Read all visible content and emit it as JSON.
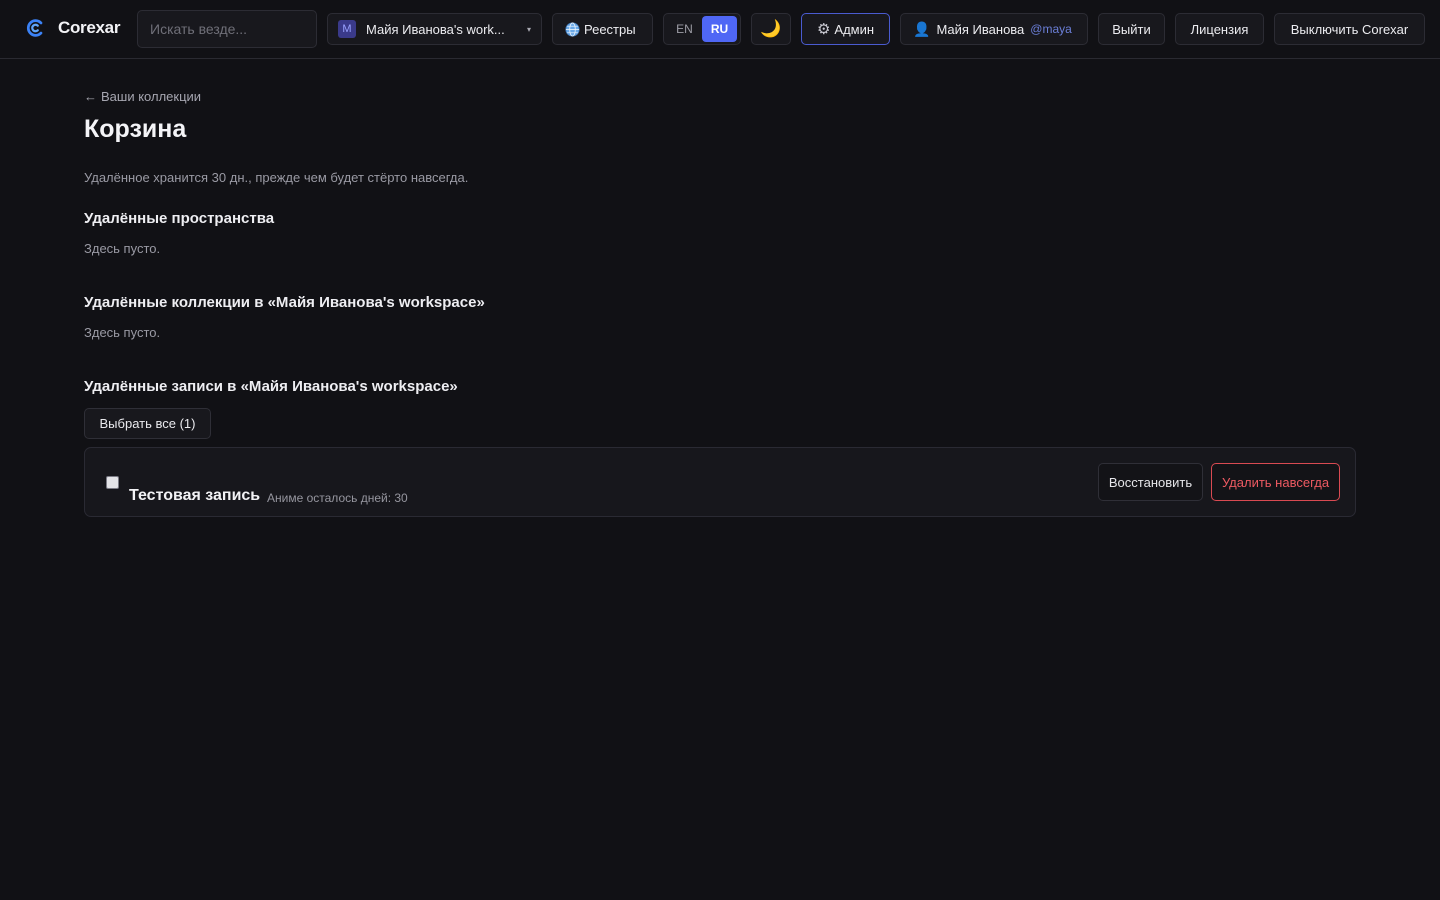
{
  "app": {
    "name": "Corexar"
  },
  "header": {
    "search_placeholder": "Искать везде...",
    "workspace": {
      "badge": "M",
      "name": "Майя Иванова's work..."
    },
    "registries_label": "Реестры",
    "languages": [
      {
        "code": "EN",
        "active": false
      },
      {
        "code": "RU",
        "active": true
      }
    ],
    "theme_icon": "🌙",
    "admin_label": "Админ",
    "user": {
      "name": "Майя Иванова",
      "handle": "@maya"
    },
    "logout_label": "Выйти",
    "license_label": "Лицензия",
    "shutdown_label": "Выключить Corexar"
  },
  "page": {
    "back_label": "Ваши коллекции",
    "title": "Корзина",
    "retention_note": "Удалённое хранится 30 дн., прежде чем будет стёрто навсегда.",
    "sections": {
      "spaces": {
        "heading": "Удалённые пространства",
        "empty_text": "Здесь пусто."
      },
      "collections": {
        "heading": "Удалённые коллекции в «Майя Иванова's workspace»",
        "empty_text": "Здесь пусто."
      },
      "records": {
        "heading": "Удалённые записи в «Майя Иванова's workspace»",
        "select_all_label": "Выбрать все (1)"
      }
    },
    "items": [
      {
        "name": "Тестовая запись",
        "meta": "Аниме осталось дней: 30",
        "restore_label": "Восстановить",
        "delete_label": "Удалить навсегда",
        "checked": false
      }
    ]
  },
  "colors": {
    "background": "#111115",
    "accent": "#4f67f5",
    "danger": "#ee5a62",
    "brand": "#3b82f6"
  }
}
